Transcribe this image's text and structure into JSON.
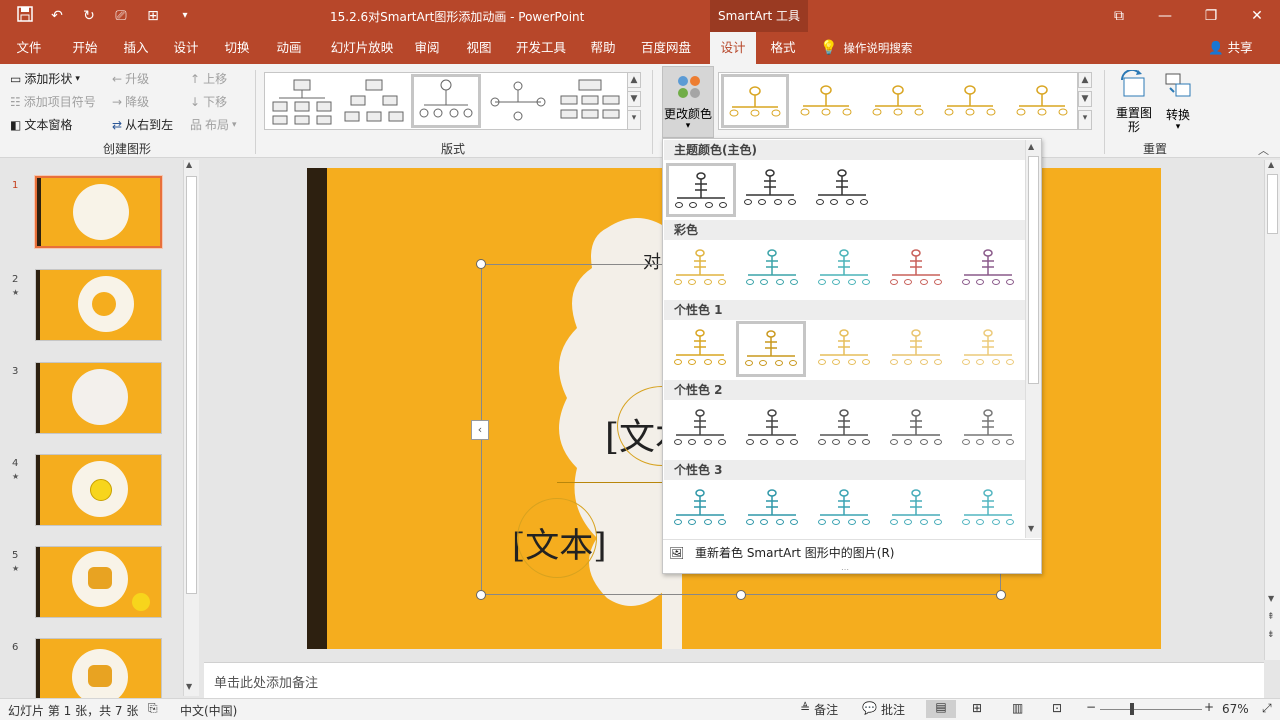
{
  "title_bar": {
    "document_title": "15.2.6对SmartArt图形添加动画 - PowerPoint",
    "context_tool": "SmartArt 工具",
    "qat_icons": [
      "save-icon",
      "undo-icon",
      "redo-icon",
      "present-from-start-icon",
      "touch-mode-icon",
      "customize-qat-icon"
    ]
  },
  "tabs": [
    "文件",
    "开始",
    "插入",
    "设计",
    "切换",
    "动画",
    "幻灯片放映",
    "审阅",
    "视图",
    "开发工具",
    "帮助",
    "百度网盘",
    "设计",
    "格式"
  ],
  "active_tab": "设计",
  "tell_me": "操作说明搜索",
  "share": "共享",
  "ribbon": {
    "create_graphic": {
      "label": "创建图形",
      "add_shape": "添加形状",
      "add_bullet": "添加项目符号",
      "text_pane": "文本窗格",
      "promote": "升级",
      "demote": "降级",
      "right_to_left": "从右到左",
      "move_up": "上移",
      "move_down": "下移",
      "layout": "布局"
    },
    "layouts_label": "版式",
    "change_colors": "更改颜色",
    "reset": {
      "label": "重置",
      "reset_graphic": "重置图形",
      "convert": "转换"
    }
  },
  "color_dropdown": {
    "sections": [
      {
        "name": "主题颜色(主色)",
        "count": 3,
        "colors": [
          "#333333",
          "#333333",
          "#333333"
        ]
      },
      {
        "name": "彩色",
        "count": 5,
        "colors": [
          "#e0b440",
          "#3aa3a8",
          "#4ab3b8",
          "#c8605a",
          "#8a5a8a"
        ]
      },
      {
        "name": "个性色 1",
        "count": 5,
        "colors": [
          "#d9a521",
          "#c9981d",
          "#e6be5a",
          "#e9c46e",
          "#ecca7a"
        ]
      },
      {
        "name": "个性色 2",
        "count": 5,
        "colors": [
          "#444444",
          "#444444",
          "#555555",
          "#666666",
          "#777777"
        ]
      },
      {
        "name": "个性色 3",
        "count": 5,
        "colors": [
          "#2e97a8",
          "#2e97a8",
          "#3aa3b2",
          "#46acb9",
          "#52b5c0"
        ]
      }
    ],
    "selected": "个性色 1 #2",
    "footer": "重新着色 SmartArt 图形中的图片(R)"
  },
  "slides": [
    {
      "num": "1"
    },
    {
      "num": "2"
    },
    {
      "num": "3"
    },
    {
      "num": "4"
    },
    {
      "num": "5"
    },
    {
      "num": "6"
    }
  ],
  "slide_canvas": {
    "title_fragment": "对",
    "text_placeholder_1": "[文本",
    "text_placeholder_2": "[文本]"
  },
  "notes_placeholder": "单击此处添加备注",
  "status_bar": {
    "slide_info": "幻灯片 第 1 张，共 7 张",
    "language": "中文(中国)",
    "notes": "备注",
    "comments": "批注",
    "zoom": "67%"
  },
  "colors": {
    "accent": "#b7472a",
    "slide_bg": "#f5ad1e",
    "slide_bar": "#2d2010"
  }
}
